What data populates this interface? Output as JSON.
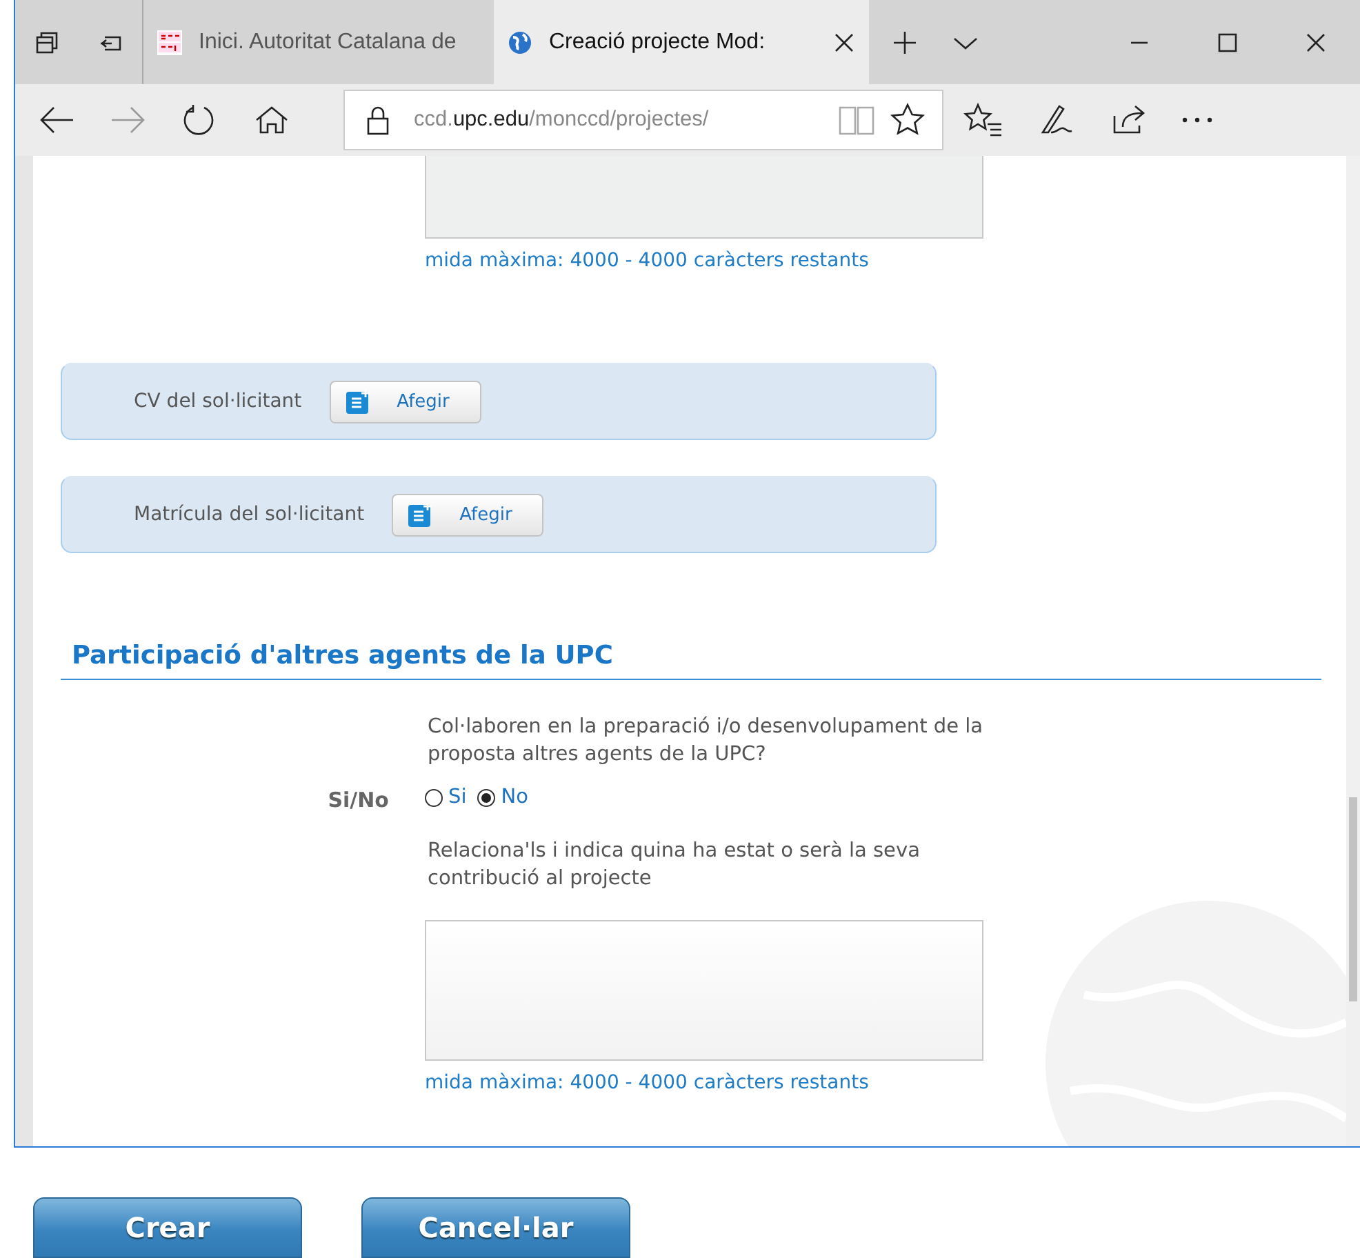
{
  "browser": {
    "tabs": [
      {
        "title": "Inici. Autoritat Catalana de",
        "kind": "gencat",
        "selected": false
      },
      {
        "title": "Creació projecte Mod:",
        "kind": "globe",
        "selected": true
      }
    ],
    "address": [
      {
        "text": "ccd.",
        "emphasis": false
      },
      {
        "text": "upc.edu",
        "emphasis": true
      },
      {
        "text": "/monccd/projectes/",
        "emphasis": false
      }
    ]
  },
  "form": {
    "top_counter": "mida màxima: 4000 - 4000 caràcters restants",
    "attachments": [
      {
        "label": "CV del sol·licitant",
        "button": "Afegir"
      },
      {
        "label": "Matrícula del sol·licitant",
        "button": "Afegir"
      }
    ],
    "section_title": "Participació d'altres agents de la UPC",
    "question": "Col·laboren en la preparació i/o desenvolupament de la proposta altres agents de la UPC?",
    "field_label": "Si/No",
    "options": [
      {
        "label": "Si",
        "selected": false
      },
      {
        "label": "No",
        "selected": true
      }
    ],
    "prompt": "Relaciona'ls i indica quina ha estat o serà la seva contribució al projecte",
    "counter": "mida màxima: 4000 - 4000 caràcters restants"
  },
  "buttons": [
    "Crear",
    "Cancel·lar"
  ]
}
